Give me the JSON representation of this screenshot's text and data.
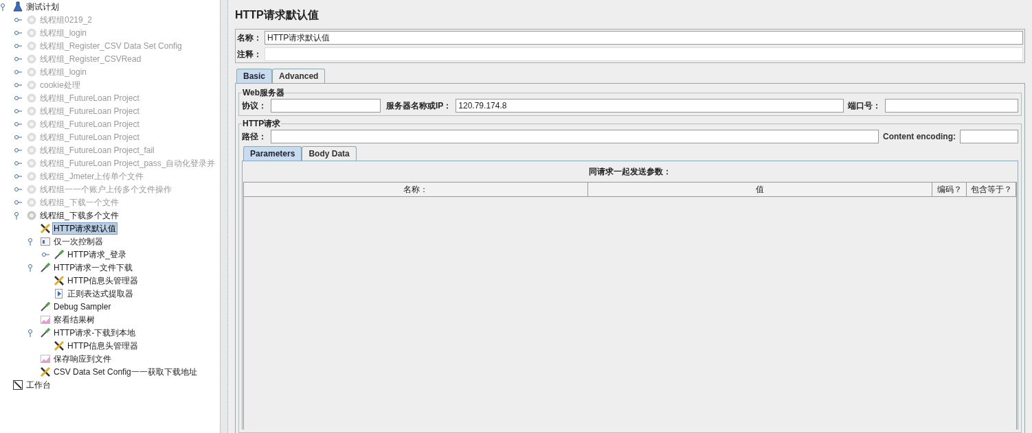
{
  "tree": [
    {
      "label": "测试计划",
      "kind": "plan",
      "expanded": true,
      "disabled": false,
      "selected": false,
      "children": [
        {
          "label": "线程组0219_2",
          "kind": "thread",
          "expanded": false,
          "disabled": true,
          "selected": false
        },
        {
          "label": "线程组_login",
          "kind": "thread",
          "expanded": false,
          "disabled": true,
          "selected": false
        },
        {
          "label": "线程组_Register_CSV Data Set Config",
          "kind": "thread",
          "expanded": false,
          "disabled": true,
          "selected": false
        },
        {
          "label": "线程组_Register_CSVRead",
          "kind": "thread",
          "expanded": false,
          "disabled": true,
          "selected": false
        },
        {
          "label": "线程组_login",
          "kind": "thread",
          "expanded": false,
          "disabled": true,
          "selected": false
        },
        {
          "label": "cookie处理",
          "kind": "thread",
          "expanded": false,
          "disabled": true,
          "selected": false
        },
        {
          "label": "线程组_FutureLoan Project",
          "kind": "thread",
          "expanded": false,
          "disabled": true,
          "selected": false
        },
        {
          "label": "线程组_FutureLoan Project",
          "kind": "thread",
          "expanded": false,
          "disabled": true,
          "selected": false
        },
        {
          "label": "线程组_FutureLoan Project",
          "kind": "thread",
          "expanded": false,
          "disabled": true,
          "selected": false
        },
        {
          "label": "线程组_FutureLoan Project",
          "kind": "thread",
          "expanded": false,
          "disabled": true,
          "selected": false
        },
        {
          "label": "线程组_FutureLoan Project_fail",
          "kind": "thread",
          "expanded": false,
          "disabled": true,
          "selected": false
        },
        {
          "label": "线程组_FutureLoan Project_pass_自动化登录并",
          "kind": "thread",
          "expanded": false,
          "disabled": true,
          "selected": false
        },
        {
          "label": "线程组_Jmeter上传单个文件",
          "kind": "thread",
          "expanded": false,
          "disabled": true,
          "selected": false
        },
        {
          "label": "线程组一一个账户上传多个文件操作",
          "kind": "thread",
          "expanded": false,
          "disabled": true,
          "selected": false
        },
        {
          "label": "线程组_下载一个文件",
          "kind": "thread",
          "expanded": false,
          "disabled": true,
          "selected": false
        },
        {
          "label": "线程组_下载多个文件",
          "kind": "thread",
          "expanded": true,
          "disabled": false,
          "selected": false,
          "children": [
            {
              "label": "HTTP请求默认值",
              "kind": "config",
              "disabled": false,
              "selected": true
            },
            {
              "label": "仅一次控制器",
              "kind": "controller",
              "expanded": true,
              "disabled": false,
              "selected": false,
              "children": [
                {
                  "label": "HTTP请求_登录",
                  "kind": "sampler",
                  "expanded": false,
                  "disabled": false,
                  "selected": false
                }
              ]
            },
            {
              "label": "HTTP请求一文件下载",
              "kind": "sampler",
              "expanded": true,
              "disabled": false,
              "selected": false,
              "children": [
                {
                  "label": "HTTP信息头管理器",
                  "kind": "config",
                  "disabled": false,
                  "selected": false
                },
                {
                  "label": "正则表达式提取器",
                  "kind": "extractor",
                  "disabled": false,
                  "selected": false
                }
              ]
            },
            {
              "label": "Debug Sampler",
              "kind": "sampler",
              "disabled": false,
              "selected": false
            },
            {
              "label": "察看结果树",
              "kind": "listener",
              "disabled": false,
              "selected": false
            },
            {
              "label": "HTTP请求-下载到本地",
              "kind": "sampler",
              "expanded": true,
              "disabled": false,
              "selected": false,
              "children": [
                {
                  "label": "HTTP信息头管理器",
                  "kind": "config",
                  "disabled": false,
                  "selected": false
                }
              ]
            },
            {
              "label": "保存响应到文件",
              "kind": "listener",
              "disabled": false,
              "selected": false
            },
            {
              "label": "CSV Data Set Config一一获取下载地址",
              "kind": "config",
              "disabled": false,
              "selected": false
            }
          ]
        }
      ]
    },
    {
      "label": "工作台",
      "kind": "workbench",
      "disabled": false,
      "selected": false
    }
  ],
  "editor": {
    "title": "HTTP请求默认值",
    "name_label": "名称：",
    "name_value": "HTTP请求默认值",
    "comment_label": "注释：",
    "tabs": [
      {
        "label": "Basic",
        "selected": true
      },
      {
        "label": "Advanced",
        "selected": false
      }
    ],
    "web_server": {
      "legend": "Web服务器",
      "protocol_label": "协议：",
      "server_label": "服务器名称或IP：",
      "server_value": "120.79.174.8",
      "port_label": "端口号："
    },
    "http_request": {
      "legend": "HTTP请求",
      "path_label": "路径：",
      "encoding_label": "Content encoding:"
    },
    "param_tabs": [
      {
        "label": "Parameters",
        "selected": true
      },
      {
        "label": "Body Data",
        "selected": false
      }
    ],
    "parameters": {
      "caption": "同请求一起发送参数：",
      "columns": [
        "名称：",
        "值",
        "编码？",
        "包含等于？"
      ]
    }
  }
}
